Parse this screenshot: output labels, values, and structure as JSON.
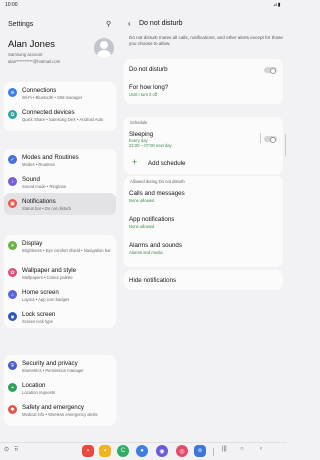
{
  "status": {
    "time": "10:00",
    "sys": "⊿▮"
  },
  "left": {
    "title": "Settings",
    "account": {
      "name": "Alan Jones",
      "line1": "Samsung account",
      "line2": "alan**********@hotmail.com"
    },
    "items": [
      {
        "label": "Connections",
        "sub": "Wi-Fi  •  Bluetooth  •  SIM manager",
        "color": "#3d7ee8",
        "glyph": "≋"
      },
      {
        "label": "Connected devices",
        "sub": "Quick Share  •  Samsung DeX  •  Android Auto",
        "color": "#2ea6a0",
        "glyph": "⧉"
      },
      {
        "label": "Modes and Routines",
        "sub": "Modes  •  Routines",
        "color": "#4a6fd6",
        "glyph": "✓"
      },
      {
        "label": "Sound",
        "sub": "Sound mode  •  Ringtone",
        "color": "#7a5cd6",
        "glyph": "♪"
      },
      {
        "label": "Notifications",
        "sub": "Status bar  •  Do not disturb",
        "color": "#e4584f",
        "glyph": "▣"
      },
      {
        "label": "Display",
        "sub": "Brightness  •  Eye comfort shield  •  Navigation bar",
        "color": "#67b53d",
        "glyph": "☀"
      },
      {
        "label": "Wallpaper and style",
        "sub": "Wallpapers  •  Colour palette",
        "color": "#e0517c",
        "glyph": "✿"
      },
      {
        "label": "Home screen",
        "sub": "Layout  •  App icon badges",
        "color": "#5a66d8",
        "glyph": "⌂"
      },
      {
        "label": "Lock screen",
        "sub": "Screen lock type",
        "color": "#2f55b8",
        "glyph": "🔒"
      },
      {
        "label": "Security and privacy",
        "sub": "Biometrics  •  Permission manager",
        "color": "#4a59c7",
        "glyph": "⛨"
      },
      {
        "label": "Location",
        "sub": "Location requests",
        "color": "#2fa25a",
        "glyph": "⌖"
      },
      {
        "label": "Safety and emergency",
        "sub": "Medical info  •  Wireless emergency alerts",
        "color": "#e2574b",
        "glyph": "✱"
      }
    ]
  },
  "right": {
    "title": "Do not disturb",
    "description": "Do not disturb mutes all calls, notifications, and other alerts except for those you choose to allow.",
    "dnd_label": "Do not disturb",
    "dnd_on": false,
    "how_long": {
      "label": "For how long?",
      "value": "Until I turn it off"
    },
    "schedule_section": "Schedule",
    "sleeping": {
      "label": "Sleeping",
      "line1": "Every day",
      "line2": "22:00 ~ 07:00 next day",
      "on": false
    },
    "add_schedule": "Add schedule",
    "allowed_section": "Allowed during Do not disturb",
    "calls": {
      "label": "Calls and messages",
      "value": "None allowed"
    },
    "apps": {
      "label": "App notifications",
      "value": "None allowed"
    },
    "alarms": {
      "label": "Alarms and sounds",
      "value": "Alarms and media"
    },
    "hide": "Hide notifications"
  },
  "navbar": {
    "apps": [
      {
        "name": "app-red-icon",
        "color": "#e84b3c"
      },
      {
        "name": "app-yellow-icon",
        "color": "#f0b323"
      },
      {
        "name": "app-green-icon",
        "color": "#2fae63"
      },
      {
        "name": "app-blue-icon",
        "color": "#3b7fe0"
      },
      {
        "name": "app-purple-icon",
        "color": "#6b5ad8"
      },
      {
        "name": "app-camera-icon",
        "color": "#e34a6c"
      }
    ]
  }
}
